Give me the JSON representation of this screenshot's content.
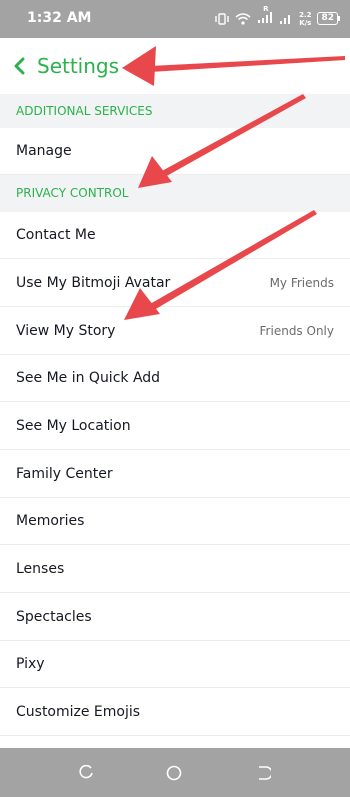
{
  "status_bar": {
    "time": "1:32 AM",
    "signal_label": "R",
    "net_speed_top": "2.2",
    "net_speed_bottom": "K/s",
    "battery": "82"
  },
  "header": {
    "title": "Settings"
  },
  "sections": [
    {
      "header": "ADDITIONAL SERVICES",
      "items": [
        {
          "label": "Manage"
        }
      ]
    },
    {
      "header": "PRIVACY CONTROL",
      "items": [
        {
          "label": "Contact Me"
        },
        {
          "label": "Use My Bitmoji Avatar",
          "value": "My Friends"
        },
        {
          "label": "View My Story",
          "value": "Friends Only"
        },
        {
          "label": "See Me in Quick Add"
        },
        {
          "label": "See My Location"
        },
        {
          "label": "Family Center"
        },
        {
          "label": "Memories"
        },
        {
          "label": "Lenses"
        },
        {
          "label": "Spectacles"
        },
        {
          "label": "Pixy"
        },
        {
          "label": "Customize Emojis"
        }
      ]
    }
  ],
  "nav_icons": [
    "recent-apps-icon",
    "home-icon",
    "back-icon"
  ],
  "colors": {
    "accent": "#2bb24c",
    "annotation_arrow": "#e8474b",
    "status_bar": "#a3a3a3"
  }
}
